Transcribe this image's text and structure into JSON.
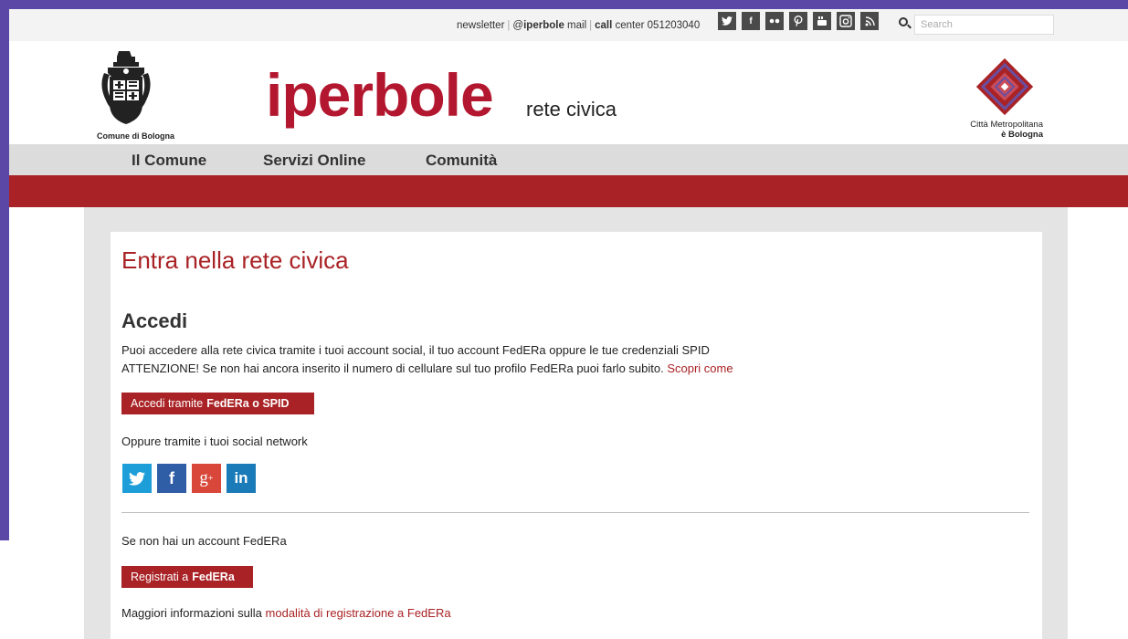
{
  "topbar": {
    "newsletter": "newsletter",
    "iperbole_prefix": "@",
    "iperbole_bold": "iperbole",
    "mail": " mail",
    "call_bold": "call",
    "call_center": " center 051203040",
    "search_placeholder": "Search",
    "social_icons": [
      "twitter-icon",
      "facebook-icon",
      "flickr-icon",
      "pinterest-icon",
      "youtube-icon",
      "instagram-icon",
      "rss-icon"
    ]
  },
  "header": {
    "logo_left_text": "Comune di Bologna",
    "brand": "iperbole",
    "brand_sub": "rete civica",
    "logo_right_line1": "Città Metropolitana",
    "logo_right_line2": "è Bologna"
  },
  "nav": {
    "items": [
      "Il Comune",
      "Servizi Online",
      "Comunità"
    ]
  },
  "content": {
    "title": "Entra nella rete civica",
    "section_title": "Accedi",
    "intro_line1": "Puoi accedere alla rete civica tramite i tuoi account social, il tuo account FedERa oppure le tue credenziali SPID",
    "intro_line2": "ATTENZIONE! Se non hai ancora inserito il numero di cellulare sul tuo profilo FedERa puoi farlo subito.",
    "intro_link": "Scopri come",
    "federa_button_prefix": "Accedi tramite",
    "federa_button_bold": "FedERa o SPID",
    "social_prompt": "Oppure tramite i tuoi social network",
    "social_buttons": [
      "twitter-icon",
      "facebook-icon",
      "google-plus-icon",
      "linkedin-icon"
    ],
    "no_account": "Se non hai un account FedERa",
    "register_button_prefix": "Registrati a",
    "register_button_bold": "FedERa",
    "more_info": "Maggiori informazioni sulla",
    "more_info_link": "modalità di registrazione a FedERa"
  },
  "colors": {
    "brand_red": "#a92225",
    "frame_purple": "#5a47a6"
  }
}
